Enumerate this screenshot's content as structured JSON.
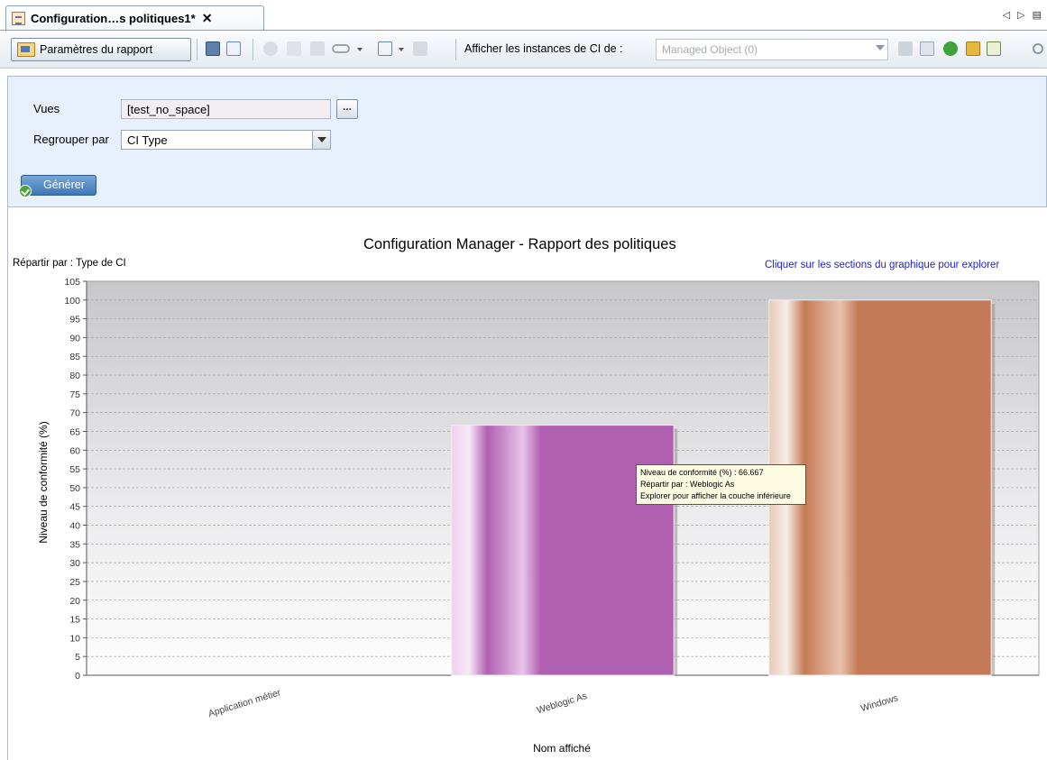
{
  "tab": {
    "title": "Configuration…s politiques1*",
    "close": "✕",
    "nav_left": "◁",
    "nav_right": "▷",
    "list": "▤"
  },
  "toolbar": {
    "report_params_label": "Paramètres du rapport",
    "show_instances_label": "Afficher les instances de CI de :",
    "instances_combo_value": "Managed Object (0)"
  },
  "params": {
    "views_label": "Vues",
    "views_value": "[test_no_space]",
    "views_browse": "...",
    "group_by_label": "Regrouper par",
    "group_by_value": "CI Type",
    "generate_label": "Générer"
  },
  "chart_data": {
    "type": "bar",
    "title": "Configuration Manager - Rapport des politiques",
    "subtitle": "Répartir par : Type de CI",
    "drill_hint": "Cliquer sur les sections du graphique pour explorer",
    "xlabel": "Nom affiché",
    "ylabel": "Niveau de conformité (%)",
    "ylim": [
      0,
      105
    ],
    "yticks": [
      0,
      5,
      10,
      15,
      20,
      25,
      30,
      35,
      40,
      45,
      50,
      55,
      60,
      65,
      70,
      75,
      80,
      85,
      90,
      95,
      100,
      105
    ],
    "grid": true,
    "categories": [
      "Application métier",
      "Weblogic As",
      "Windows"
    ],
    "values": [
      0,
      66.667,
      100
    ],
    "colors": [
      "#c9a8d8",
      "#b060b0",
      "#c47a56"
    ],
    "tooltip": {
      "line1": "Niveau de conformité (%) : 66.667",
      "line2": "Répartir par : Weblogic As",
      "line3": "Explorer pour afficher la couche inférieure"
    }
  }
}
